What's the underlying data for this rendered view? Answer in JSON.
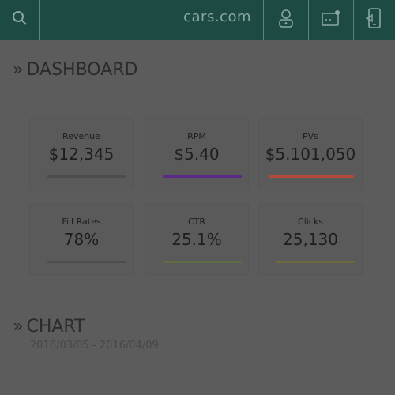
{
  "header": {
    "brand": "cars.com",
    "icons": [
      "search-icon",
      "user-icon",
      "message-icon",
      "phone-icon"
    ]
  },
  "dashboard": {
    "title": "DASHBOARD",
    "cards": [
      {
        "label": "Revenue",
        "value": "$12,345",
        "accent": "#4d4d4d"
      },
      {
        "label": "RPM",
        "value": "$5.40",
        "accent": "#5a2a86"
      },
      {
        "label": "PVs",
        "value": "$5.101,050",
        "accent": "#b24a3a"
      },
      {
        "label": "Fill Rates",
        "value": "78%",
        "accent": "#4d4d4d"
      },
      {
        "label": "CTR",
        "value": "25.1%",
        "accent": "#5f6b43"
      },
      {
        "label": "Clicks",
        "value": "25,130",
        "accent": "#6b6b3f"
      }
    ]
  },
  "chart": {
    "title": "CHART",
    "date_range": "2016/03/05 - 2016/04/09"
  }
}
